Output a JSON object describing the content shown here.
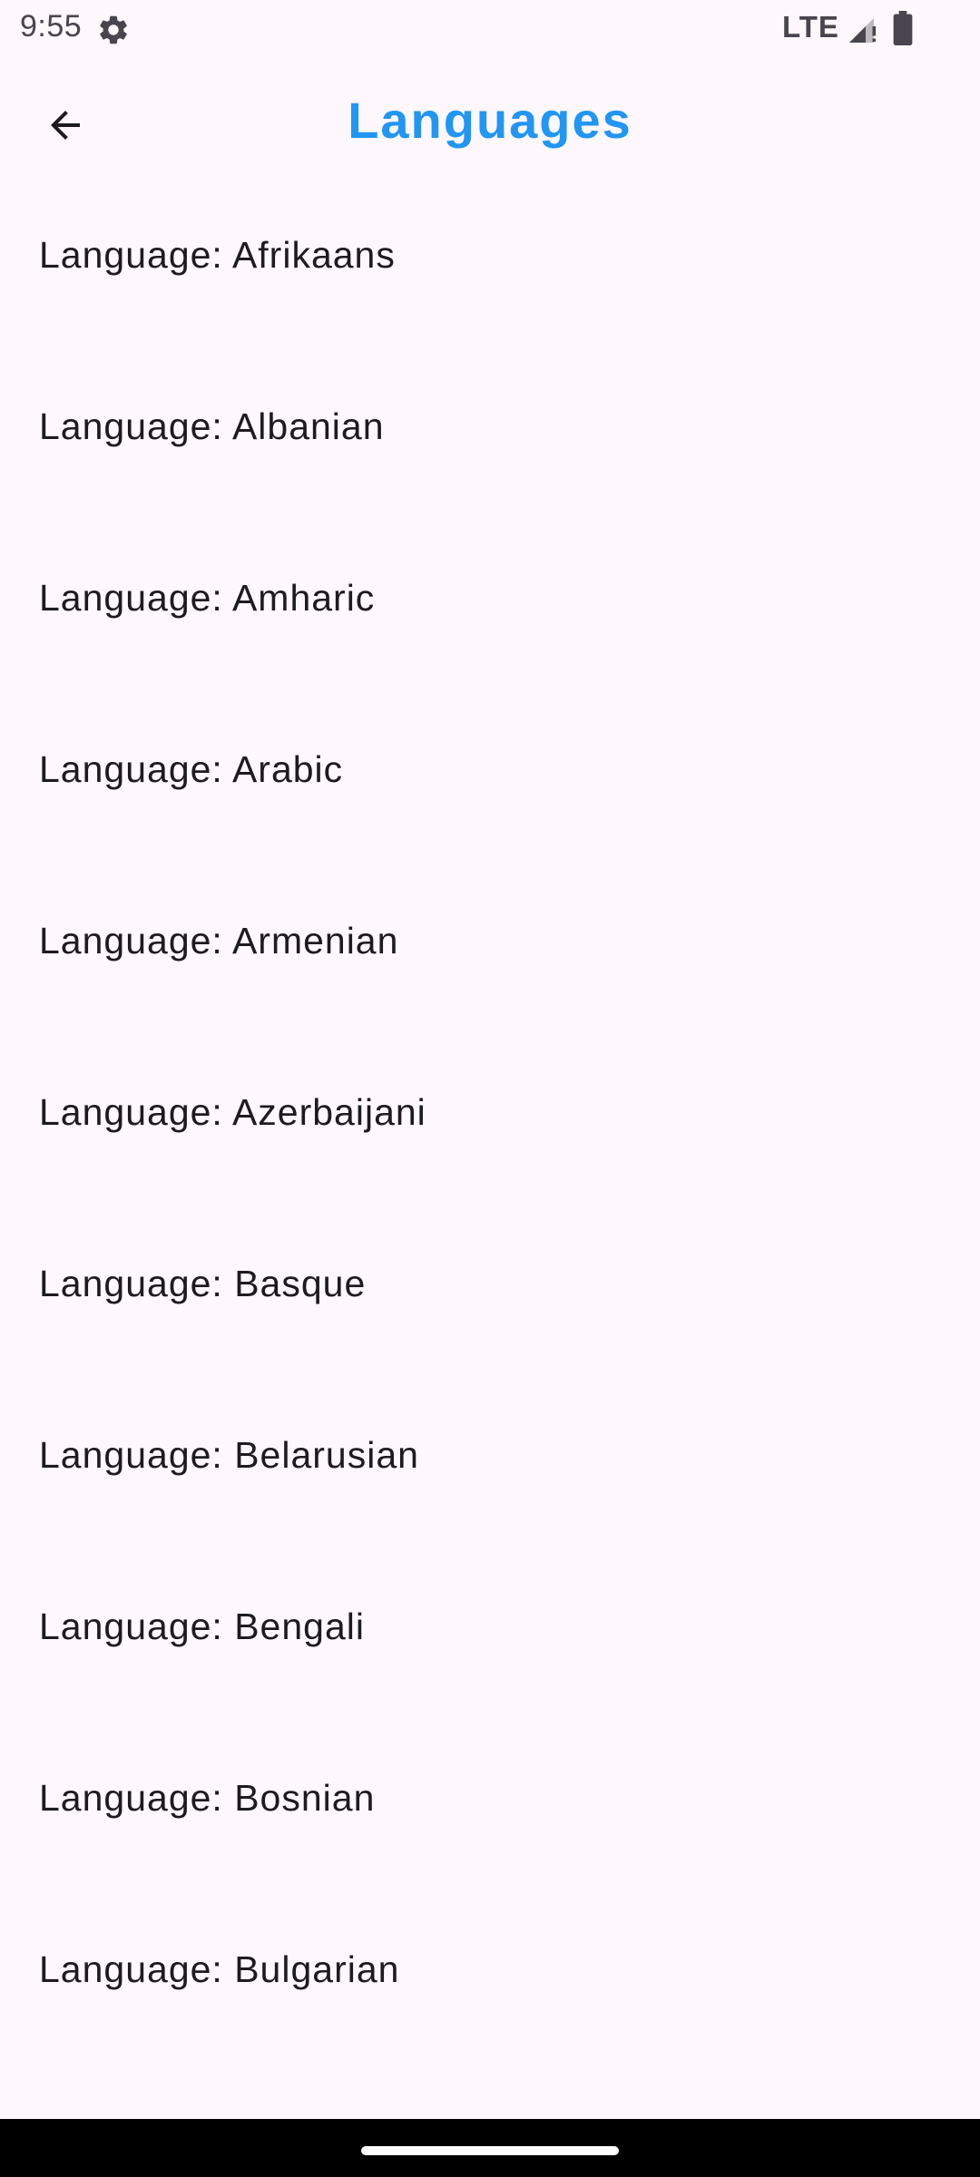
{
  "status_bar": {
    "time": "9:55",
    "network": "LTE",
    "icons": [
      "gear-icon",
      "signal-icon",
      "battery-icon"
    ]
  },
  "app_bar": {
    "title": "Languages",
    "back_icon": "arrow-left-icon",
    "title_color": "#2196f3"
  },
  "languages": [
    {
      "label": "Language: Afrikaans"
    },
    {
      "label": "Language: Albanian"
    },
    {
      "label": "Language: Amharic"
    },
    {
      "label": "Language: Arabic"
    },
    {
      "label": "Language: Armenian"
    },
    {
      "label": "Language: Azerbaijani"
    },
    {
      "label": "Language: Basque"
    },
    {
      "label": "Language: Belarusian"
    },
    {
      "label": "Language: Bengali"
    },
    {
      "label": "Language: Bosnian"
    },
    {
      "label": "Language: Bulgarian"
    }
  ],
  "colors": {
    "background": "#fef7fb",
    "text": "#1d1b20",
    "accent": "#2196f3"
  }
}
